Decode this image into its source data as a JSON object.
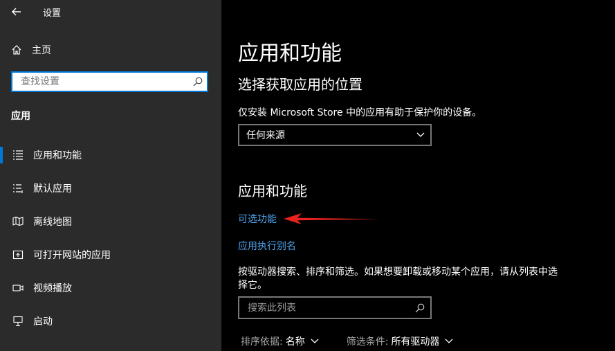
{
  "window": {
    "title": "设置",
    "back_icon": "back-arrow-icon"
  },
  "sidebar": {
    "home_label": "主页",
    "search_placeholder": "查找设置",
    "section_label": "应用",
    "items": [
      {
        "label": "应用和功能",
        "icon": "list-icon",
        "selected": true
      },
      {
        "label": "默认应用",
        "icon": "list-icon",
        "selected": false
      },
      {
        "label": "离线地图",
        "icon": "map-icon",
        "selected": false
      },
      {
        "label": "可打开网站的应用",
        "icon": "open-external-icon",
        "selected": false
      },
      {
        "label": "视频播放",
        "icon": "video-icon",
        "selected": false
      },
      {
        "label": "启动",
        "icon": "startup-icon",
        "selected": false
      }
    ]
  },
  "main": {
    "page_title": "应用和功能",
    "install_heading": "选择获取应用的位置",
    "install_description": "仅安装 Microsoft Store 中的应用有助于保护你的设备。",
    "install_dropdown_value": "任何来源",
    "apps_heading": "应用和功能",
    "optional_features_link": "可选功能",
    "app_alias_link": "应用执行别名",
    "apps_description": "按驱动器搜索、排序和筛选。如果想要卸载或移动某个应用，请从列表中选择它。",
    "list_search_placeholder": "搜索此列表",
    "sort_label": "排序依据:",
    "sort_value": "名称",
    "filter_label": "筛选条件:",
    "filter_value": "所有驱动器"
  },
  "colors": {
    "accent": "#0078d7",
    "link": "#4ea4ee",
    "annotation_arrow": "#e8231f",
    "sidebar_bg": "#2b2b2b",
    "main_bg": "#000000"
  }
}
